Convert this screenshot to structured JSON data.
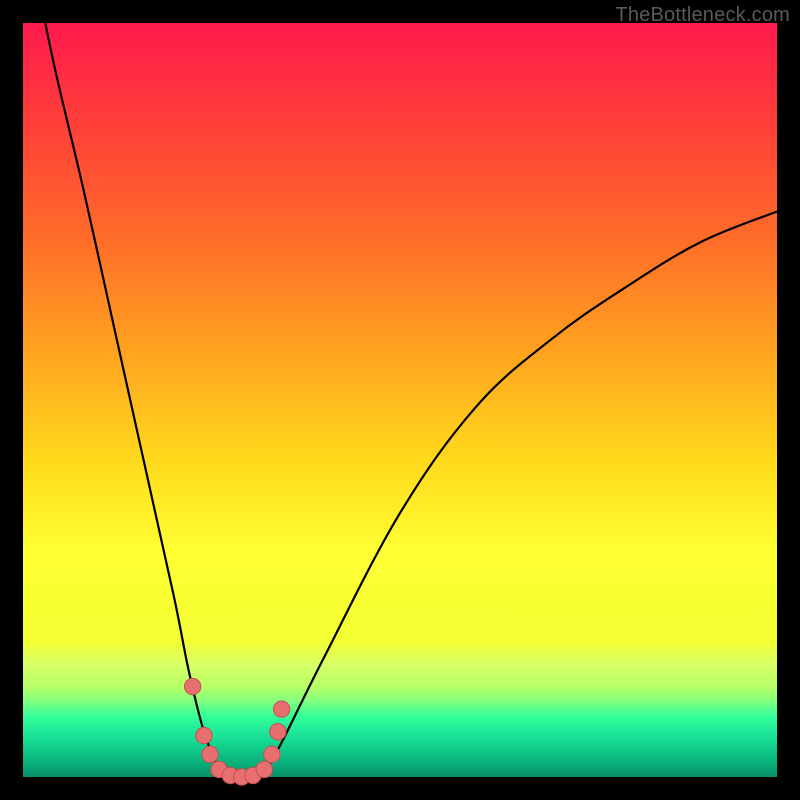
{
  "watermark": "TheBottleneck.com",
  "chart_data": {
    "type": "line",
    "title": "",
    "xlabel": "",
    "ylabel": "",
    "xlim": [
      0,
      100
    ],
    "ylim": [
      0,
      100
    ],
    "grid": false,
    "series": [
      {
        "name": "bottleneck-curve",
        "x": [
          1,
          4,
          8,
          12,
          16,
          20,
          22,
          24,
          26,
          27,
          28,
          30,
          32,
          34,
          40,
          50,
          60,
          70,
          80,
          90,
          100
        ],
        "y": [
          110,
          95,
          78,
          60,
          42,
          24,
          14,
          6,
          1,
          0,
          0,
          0,
          1,
          4,
          16,
          35,
          49,
          58,
          65,
          71,
          75
        ]
      }
    ],
    "markers": {
      "name": "highlighted-points",
      "x": [
        22.5,
        24.0,
        24.8,
        26.0,
        27.5,
        29.0,
        30.5,
        32.0,
        33.0,
        33.8,
        34.3
      ],
      "y": [
        12.0,
        5.5,
        3.0,
        1.0,
        0.2,
        0.0,
        0.2,
        1.0,
        3.0,
        6.0,
        9.0
      ]
    },
    "colors": {
      "curve": "#000000",
      "marker_fill": "#e76f6f",
      "marker_stroke": "#c94f4f",
      "gradient_top": "#ff1a4d",
      "gradient_bottom": "#078f6a"
    }
  }
}
